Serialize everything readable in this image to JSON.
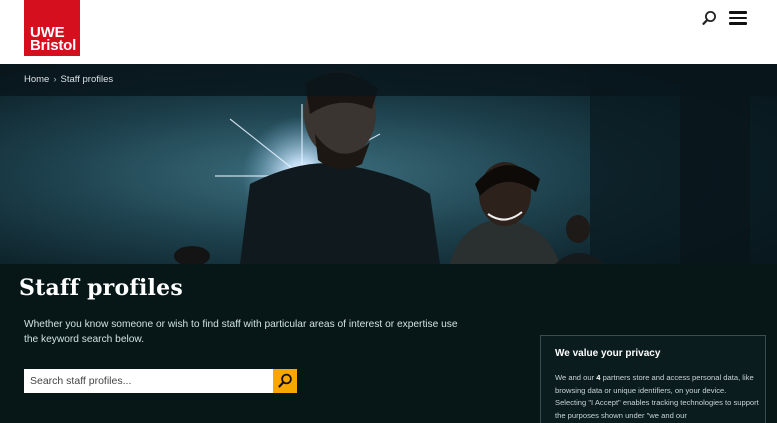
{
  "brand": {
    "line1": "UWE",
    "line2": "Bristol",
    "color": "#d50f1e"
  },
  "header": {
    "search_icon": "search-icon",
    "menu_icon": "hamburger-menu-icon"
  },
  "breadcrumb": {
    "home": "Home",
    "separator": "›",
    "current": "Staff profiles"
  },
  "hero": {
    "title": "Staff profiles"
  },
  "intro": "Whether you know someone or wish to find staff with particular areas of interest or expertise use the keyword search below.",
  "search": {
    "placeholder": "Search staff profiles...",
    "accent": "#f7a800"
  },
  "privacy": {
    "heading": "We value your privacy",
    "text_before": "We and our ",
    "partner_count": "4",
    "text_after": " partners store and access personal data, like browsing data or unique identifiers, on your device. Selecting \"I Accept\" enables tracking technologies to support the purposes shown under \"we and our"
  }
}
